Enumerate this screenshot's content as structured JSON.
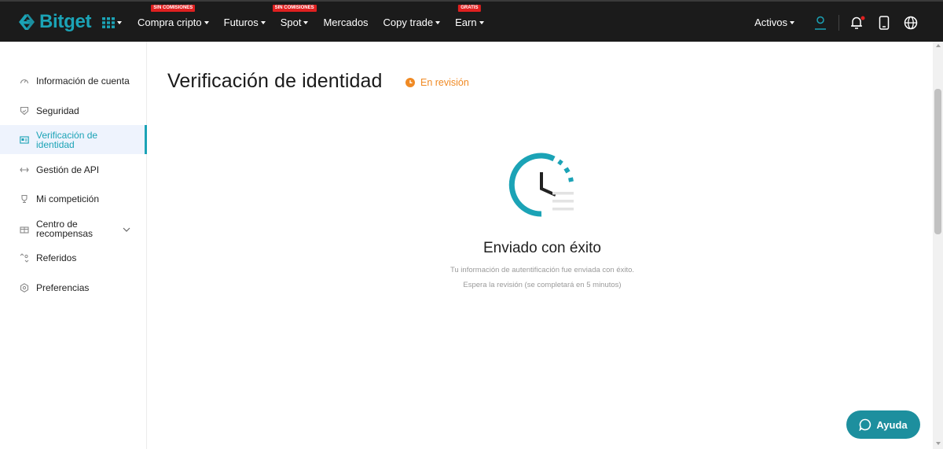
{
  "brand": {
    "name": "Bitget",
    "accent": "#1ba3b6"
  },
  "nav": {
    "items": [
      {
        "label": "Compra cripto",
        "badge": "SIN COMISIONES",
        "dropdown": true
      },
      {
        "label": "Futuros",
        "badge": "",
        "dropdown": true
      },
      {
        "label": "Spot",
        "badge": "SIN COMISIONES",
        "dropdown": true
      },
      {
        "label": "Mercados",
        "badge": "",
        "dropdown": false
      },
      {
        "label": "Copy trade",
        "badge": "",
        "dropdown": true
      },
      {
        "label": "Earn",
        "badge": "GRATIS",
        "dropdown": true
      }
    ],
    "activos_label": "Activos",
    "icons": [
      "user-icon",
      "bell-icon",
      "phone-icon",
      "globe-icon"
    ]
  },
  "sidebar": {
    "items": [
      {
        "label": "Información de cuenta",
        "icon": "gauge-icon"
      },
      {
        "label": "Seguridad",
        "icon": "shield-icon"
      },
      {
        "label": "Verificación de identidad",
        "icon": "id-card-icon",
        "active": true
      },
      {
        "label": "Gestión de API",
        "icon": "api-icon"
      },
      {
        "label": "Mi competición",
        "icon": "trophy-icon"
      },
      {
        "label": "Centro de recompensas",
        "icon": "gift-icon",
        "expandable": true
      },
      {
        "label": "Referidos",
        "icon": "referral-icon"
      },
      {
        "label": "Preferencias",
        "icon": "hexagon-settings-icon"
      }
    ]
  },
  "main": {
    "title": "Verificación de identidad",
    "status": "En revisión",
    "status_color": "#f08a24",
    "success_title": "Enviado con éxito",
    "success_line1": "Tu información de autentificación fue enviada con éxito.",
    "success_line2": "Espera la revisión (se completará en 5 minutos)"
  },
  "help": {
    "label": "Ayuda",
    "color": "#1d8f9e"
  }
}
